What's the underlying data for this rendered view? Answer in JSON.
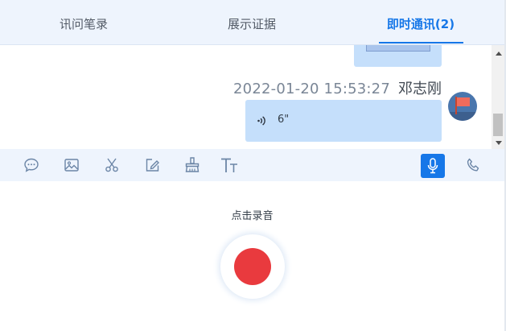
{
  "tabs": [
    {
      "label": "讯问笔录",
      "active": false
    },
    {
      "label": "展示证据",
      "active": false
    },
    {
      "label": "即时通讯(2)",
      "active": true
    }
  ],
  "message": {
    "time": "2022-01-20 15:53:27",
    "sender": "邓志刚",
    "voice_duration": "6\"",
    "avatar_icon": "red-flag-icon"
  },
  "toolbar": {
    "icons": [
      "chat-bubble-icon",
      "image-icon",
      "scissors-icon",
      "edit-icon",
      "clear-broom-icon",
      "font-size-icon",
      "microphone-icon",
      "phone-icon"
    ],
    "active": "microphone-icon"
  },
  "recorder": {
    "label": "点击录音"
  },
  "colors": {
    "accent": "#1677e8",
    "bubble": "#c5dffb",
    "record": "#e93a3e",
    "tab_bg": "#eef4fd"
  }
}
